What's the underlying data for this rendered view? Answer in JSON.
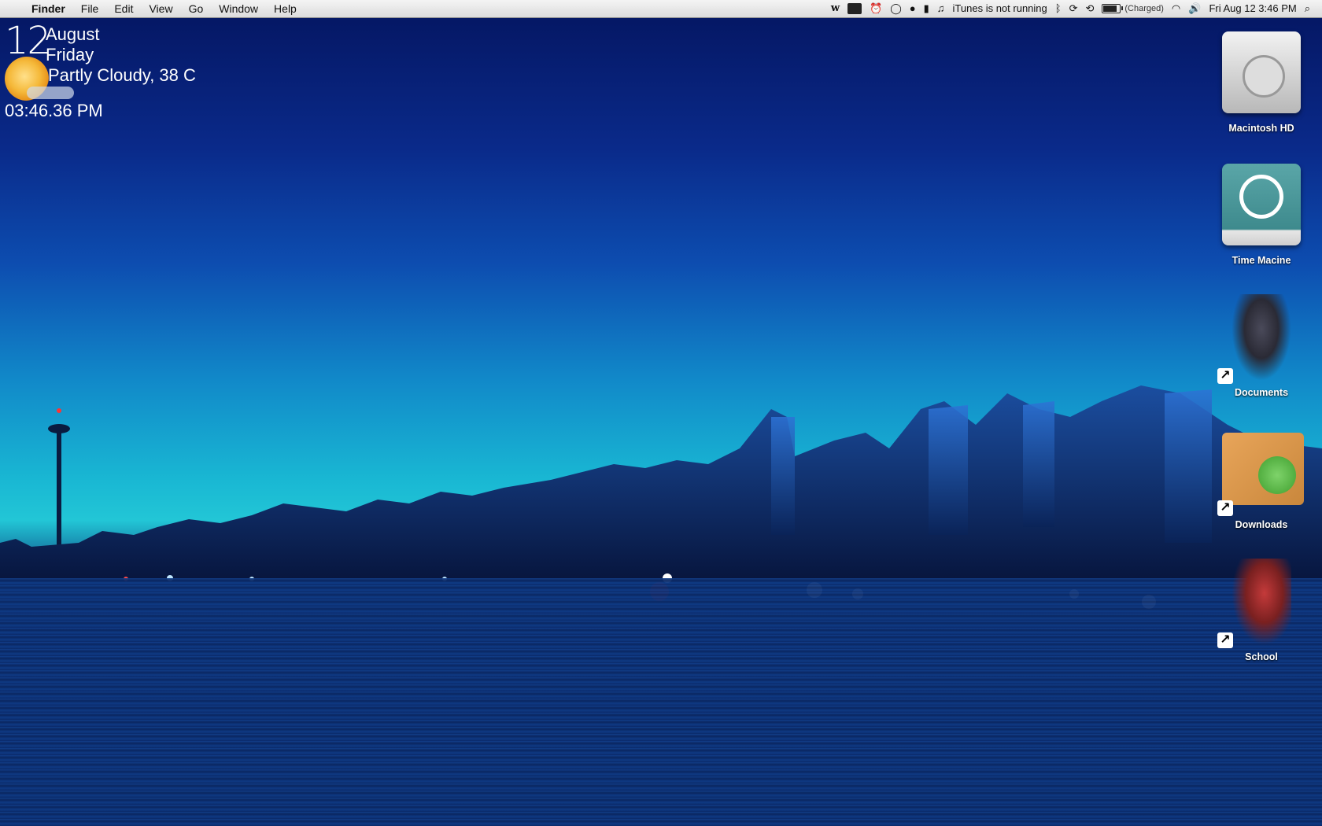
{
  "menubar": {
    "apple_glyph": "",
    "app_name": "Finder",
    "menus": [
      "File",
      "Edit",
      "View",
      "Go",
      "Window",
      "Help"
    ],
    "status": {
      "w_icon_text": "w",
      "itunes": "iTunes is not running",
      "battery_status": "(Charged)",
      "datetime": "Fri Aug 12  3:46 PM"
    }
  },
  "widget": {
    "day_number": "12",
    "month": "August",
    "weekday": "Friday",
    "weather": "Partly Cloudy, 38 C",
    "time": "03:46.36 PM"
  },
  "desktop_icons": [
    {
      "label": "Macintosh HD"
    },
    {
      "label": "Time Macine"
    },
    {
      "label": "Documents"
    },
    {
      "label": "Downloads"
    },
    {
      "label": "School"
    }
  ],
  "colors": {
    "sky_top": "#041560",
    "sky_horizon": "#22c6d6",
    "water": "#0b2a6a"
  }
}
